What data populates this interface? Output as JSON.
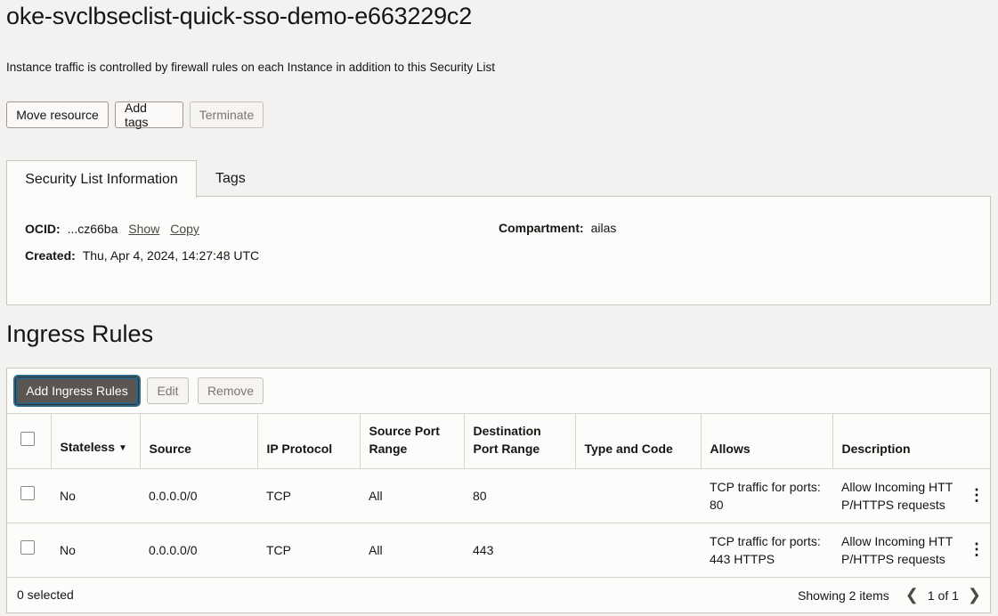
{
  "page": {
    "title": "oke-svclbseclist-quick-sso-demo-e663229c2",
    "subtitle": "Instance traffic is controlled by firewall rules on each Instance in addition to this Security List"
  },
  "actions": {
    "move_resource": "Move resource",
    "add_tags": "Add tags",
    "terminate": "Terminate"
  },
  "tabs": [
    {
      "label": "Security List Information",
      "active": true
    },
    {
      "label": "Tags",
      "active": false
    }
  ],
  "info": {
    "ocid_label": "OCID:",
    "ocid_value": "...cz66ba",
    "show_link": "Show",
    "copy_link": "Copy",
    "created_label": "Created:",
    "created_value": "Thu, Apr 4, 2024, 14:27:48 UTC",
    "compartment_label": "Compartment:",
    "compartment_value": "ailas"
  },
  "ingress": {
    "section_title": "Ingress Rules",
    "toolbar": {
      "add": "Add Ingress Rules",
      "edit": "Edit",
      "remove": "Remove"
    },
    "columns": [
      "Stateless",
      "Source",
      "IP Protocol",
      "Source Port Range",
      "Destination Port Range",
      "Type and Code",
      "Allows",
      "Description"
    ],
    "rows": [
      {
        "stateless": "No",
        "source": "0.0.0.0/0",
        "protocol": "TCP",
        "src_port": "All",
        "dst_port": "80",
        "type_code": "",
        "allows": "TCP traffic for ports: 80",
        "description": "Allow Incoming HTTP/HTTPS requests"
      },
      {
        "stateless": "No",
        "source": "0.0.0.0/0",
        "protocol": "TCP",
        "src_port": "All",
        "dst_port": "443",
        "type_code": "",
        "allows": "TCP traffic for ports: 443 HTTPS",
        "description": "Allow Incoming HTTP/HTTPS requests"
      }
    ],
    "footer": {
      "selected": "0 selected",
      "showing": "Showing 2 items",
      "page": "1 of 1"
    }
  },
  "colors": {
    "background": "#f3f2f1",
    "primary_button": "#5b5652",
    "border": "#c9c5c1"
  }
}
